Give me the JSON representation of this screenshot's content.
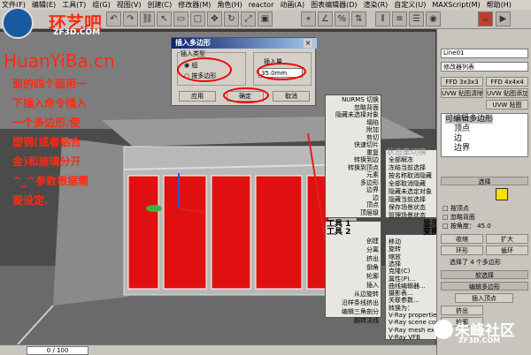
{
  "menubar": [
    "文件(F)",
    "编辑(E)",
    "工具(T)",
    "组(G)",
    "视图(V)",
    "创建(C)",
    "修改器(M)",
    "角色(H)",
    "reactor",
    "动画(A)",
    "图表编辑器(D)",
    "渲染(R)",
    "自定义(U)",
    "MAXScript(M)",
    "帮助(H)"
  ],
  "watermark": {
    "logo_text": "环艺吧",
    "logo_sub": "ZF3D.COM",
    "url": "HuanYiBa.cn",
    "corner_text": "朱峰社区",
    "corner_sub": "ZF3D.COM"
  },
  "instructions": [
    "面的四个面用一",
    "下插入命令插入",
    "一个多边形.使",
    "塑钢(或者铝合",
    "金)和玻璃分开",
    "^_^参数根据需",
    "要设定."
  ],
  "dialog": {
    "title": "插入多边形",
    "group_type": "插入类型",
    "opt_group": "组",
    "opt_by_polygon": "按多边形",
    "amount_label": "插入量",
    "amount_value": "35.0mm",
    "apply": "应用",
    "ok": "确定",
    "cancel": "取消"
  },
  "quad_left": [
    "NURMS 切换",
    "忽略背面",
    "隐藏未选择对象",
    "塌陷",
    "附加",
    "剪切",
    "快速切片",
    "重复",
    "转换到边",
    "转换到顶点",
    "元素",
    "多边形",
    "边界",
    "边",
    "顶点",
    "顶层级"
  ],
  "quad_right_top": [
    "全部解冻",
    "冻结当前选择",
    "按名称取消隐藏",
    "全部取消隐藏",
    "隐藏未选定对象",
    "隐藏当前选择",
    "保存场景状态",
    "管理场景状态"
  ],
  "quad_right_title": "显示",
  "quad_disabled": "状态集切换",
  "quad_tools1": "工具 1",
  "quad_tools2": "工具 2",
  "quad_transform": "变换",
  "quad_left2": [
    "创建",
    "分离",
    "挤出",
    "倒角",
    "轮廓",
    "插入",
    "从边旋转",
    "沿样条线挤出",
    "编辑三角剖分",
    "翻转法线"
  ],
  "quad_right2": [
    "移动",
    "旋转",
    "缩放",
    "选择",
    "克隆(C)",
    "属性(P)...",
    "曲线编辑器...",
    "摄影表...",
    "关联参数...",
    "转换为：",
    "V-Ray properties",
    "V-Ray scene converter",
    "V-Ray mesh export",
    "V-Ray VFB"
  ],
  "cmd": {
    "object_name": "Line01",
    "modlist": "修改器列表",
    "btns": [
      "FFD 3x3x3",
      "FFD 4x4x4",
      "UVW 贴图清除",
      "UVW 贴图添加",
      "UVW 贴图"
    ],
    "stack": [
      "可编辑多边形",
      "顶点",
      "边",
      "边界"
    ],
    "select": "选择",
    "by_vertex": "按顶点",
    "ignore_back": "忽略背面",
    "by_angle": "按角度：",
    "angle": "45.0",
    "shrink": "收缩",
    "grow": "扩大",
    "ring": "环形",
    "loop": "循环",
    "select_status": "选择了 4 个多边形",
    "soft_sel": "软选择",
    "edit_poly": "编辑多边形",
    "insert_vert": "插入顶点",
    "extrude": "挤出",
    "outline": "轮廓"
  },
  "status": {
    "frames": "0 / 100"
  },
  "colors": {
    "glass": "#e01010",
    "accent": "#ff2a10",
    "dlgTitle": "#0a246a"
  }
}
